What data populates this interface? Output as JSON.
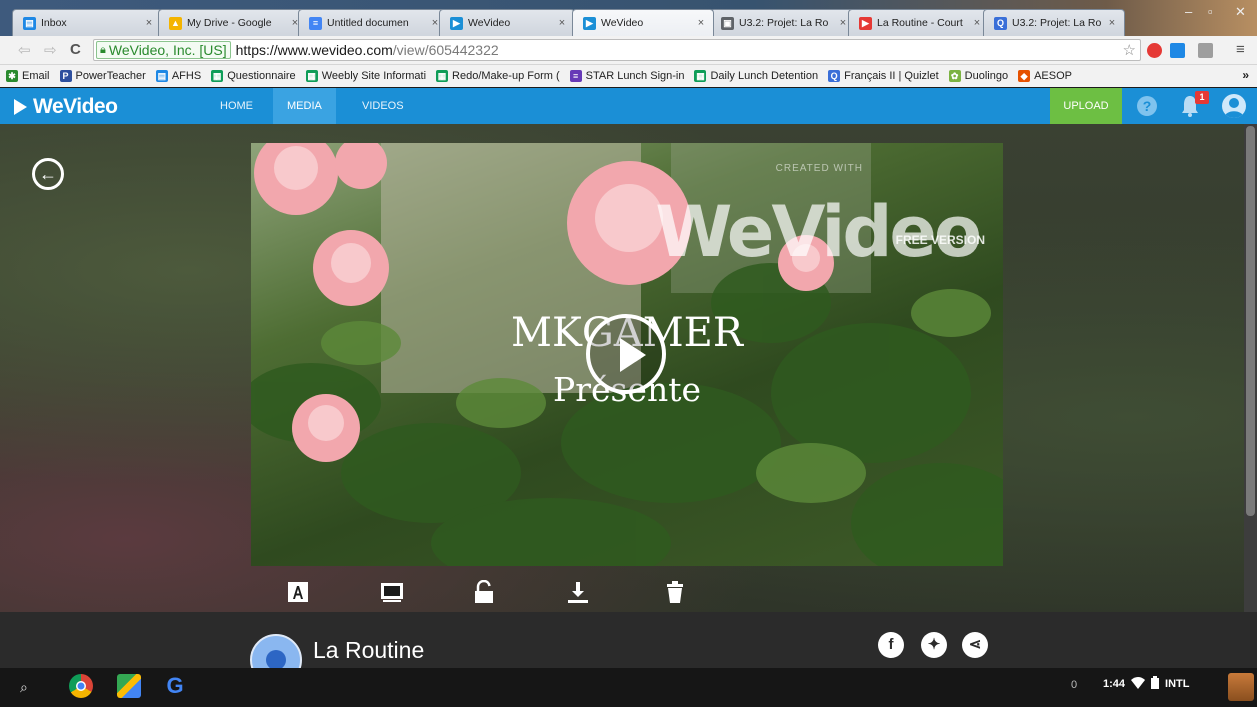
{
  "browser": {
    "tabs": [
      {
        "title": "Inbox",
        "color": "#1e88e5",
        "glyph": "▤"
      },
      {
        "title": "My Drive - Google",
        "color": "#f4b400",
        "glyph": "▲"
      },
      {
        "title": "Untitled documen",
        "color": "#4285f4",
        "glyph": "≡"
      },
      {
        "title": "WeVideo",
        "color": "#1b8fd6",
        "glyph": "▶"
      },
      {
        "title": "WeVideo",
        "color": "#1b8fd6",
        "glyph": "▶"
      },
      {
        "title": "U3.2: Projet: La Ro",
        "color": "#5f6368",
        "glyph": "▣"
      },
      {
        "title": "La Routine - Court",
        "color": "#e53935",
        "glyph": "▶"
      },
      {
        "title": "U3.2: Projet: La Ro",
        "color": "#3a6fd8",
        "glyph": "Q"
      }
    ],
    "ev_label": "WeVideo, Inc. [US]",
    "url_host": "https://www.wevideo.com",
    "url_path": "/view/605442322"
  },
  "bookmarks": [
    {
      "label": "Email",
      "color": "#2a8a2e",
      "glyph": "✱"
    },
    {
      "label": "PowerTeacher",
      "color": "#2d4f9e",
      "glyph": "P"
    },
    {
      "label": "AFHS",
      "color": "#1e88e5",
      "glyph": "▤"
    },
    {
      "label": "Questionnaire",
      "color": "#0f9d58",
      "glyph": "▦"
    },
    {
      "label": "Weebly Site Informati",
      "color": "#0f9d58",
      "glyph": "▦"
    },
    {
      "label": "Redo/Make-up Form (",
      "color": "#0f9d58",
      "glyph": "▦"
    },
    {
      "label": "STAR Lunch Sign-in",
      "color": "#673ab7",
      "glyph": "≡"
    },
    {
      "label": "Daily Lunch Detention",
      "color": "#0f9d58",
      "glyph": "▦"
    },
    {
      "label": "Français II | Quizlet",
      "color": "#3a6fd8",
      "glyph": "Q"
    },
    {
      "label": "Duolingo",
      "color": "#7cb342",
      "glyph": "✿"
    },
    {
      "label": "AESOP",
      "color": "#e65100",
      "glyph": "◆"
    }
  ],
  "bookmarks_more": "»",
  "app": {
    "logo": "WeVideo",
    "nav": [
      "HOME",
      "MEDIA",
      "VIDEOS"
    ],
    "upload": "UPLOAD",
    "help": "?",
    "notifications": "1"
  },
  "video": {
    "title_line1": "MKGAMER",
    "title_line2": "Présente",
    "watermark": "WeVideo",
    "watermark_top": "CREATED WITH",
    "watermark_sub": "FREE VERSION"
  },
  "media": {
    "title": "La Routine"
  },
  "shelf": {
    "notifications": "0",
    "time": "1:44",
    "ime": "INTL"
  }
}
